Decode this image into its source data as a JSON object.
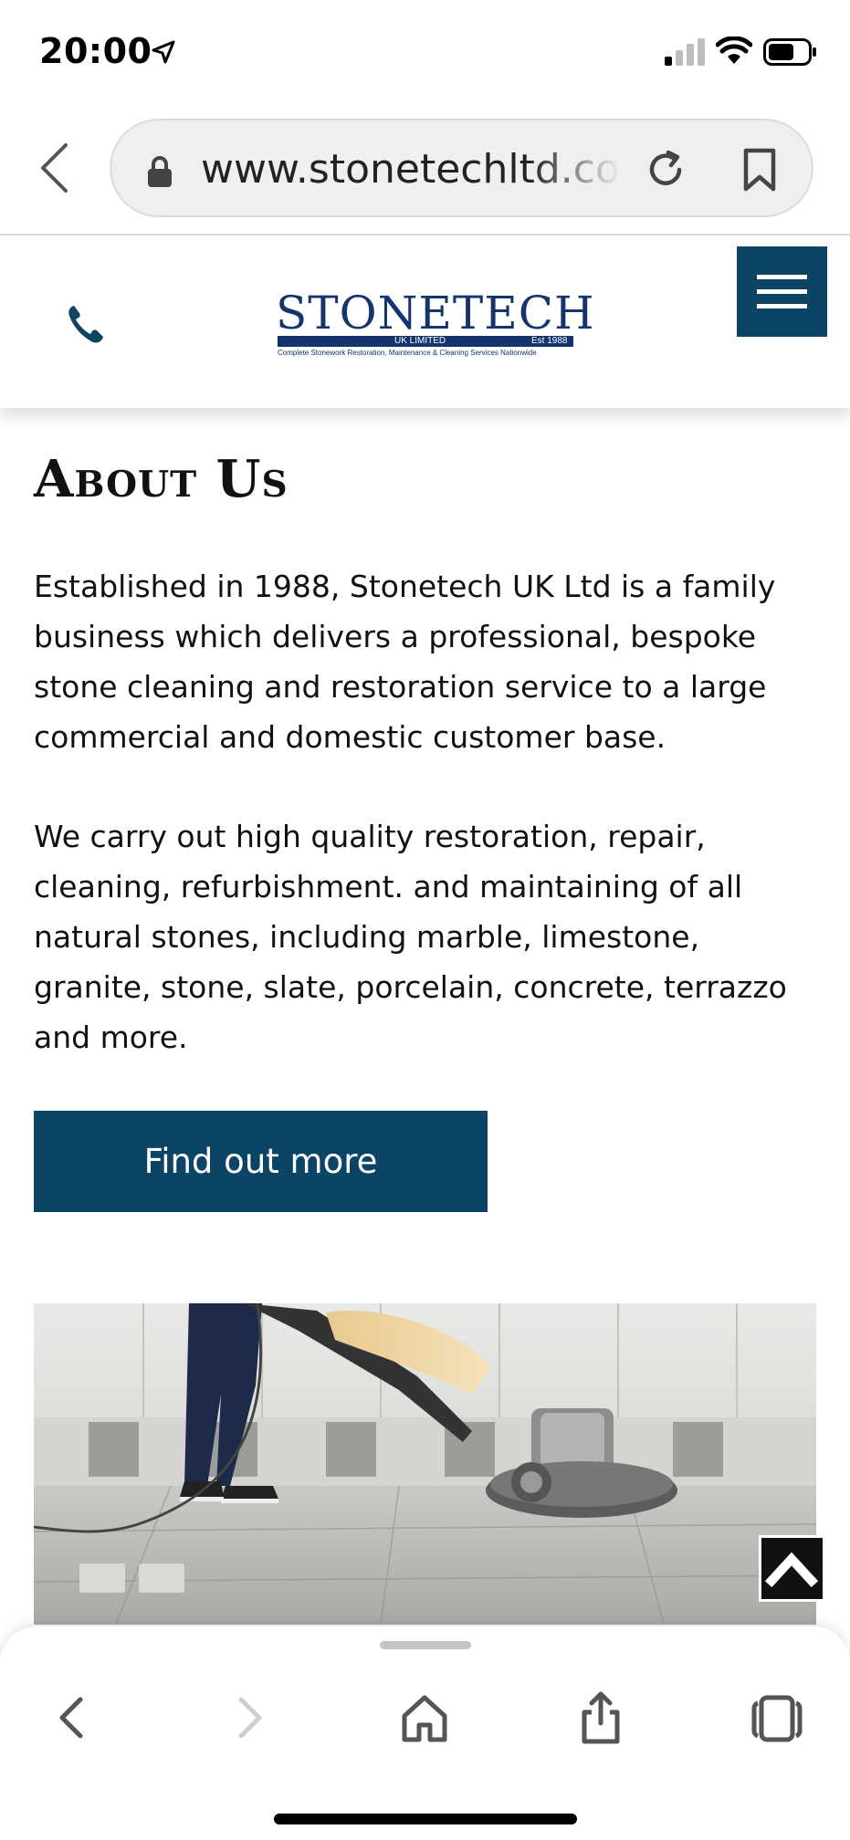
{
  "status_bar": {
    "time": "20:00",
    "icons": [
      "location-arrow-icon",
      "signal-icon",
      "wifi-icon",
      "battery-icon"
    ]
  },
  "browser": {
    "url": "www.stonetechltd.com",
    "icons": [
      "back-arrow-icon",
      "lock-icon",
      "reload-icon",
      "bookmark-icon"
    ]
  },
  "header": {
    "logo": {
      "name": "STONETECH",
      "sub_left": "UK LIMITED",
      "sub_right": "Est 1988",
      "tagline": "Complete Stonework Restoration, Maintenance & Cleaning Services Nationwide"
    },
    "icons": [
      "phone-icon",
      "hamburger-menu-icon"
    ]
  },
  "content": {
    "title": "About Us",
    "paragraphs": [
      "Established in 1988, Stonetech UK Ltd is a family business which delivers a professional, bespoke stone cleaning and restoration service to a large commercial and domestic customer base.",
      "We carry out high quality restoration, repair, cleaning, refurbishment. and maintaining of all natural stones, including marble, limestone, granite, stone, slate, porcelain, concrete, terrazzo and more."
    ],
    "button_label": "Find out more",
    "photo": "floor-polishing-photo"
  },
  "toolbar": {
    "icons": [
      "back-icon",
      "forward-icon",
      "home-icon",
      "share-icon",
      "tabs-icon"
    ],
    "forward_enabled": false
  },
  "colors": {
    "brand_navy": "#0c4466",
    "logo_blue": "#14346b",
    "scroll_top_bg": "#111111"
  }
}
